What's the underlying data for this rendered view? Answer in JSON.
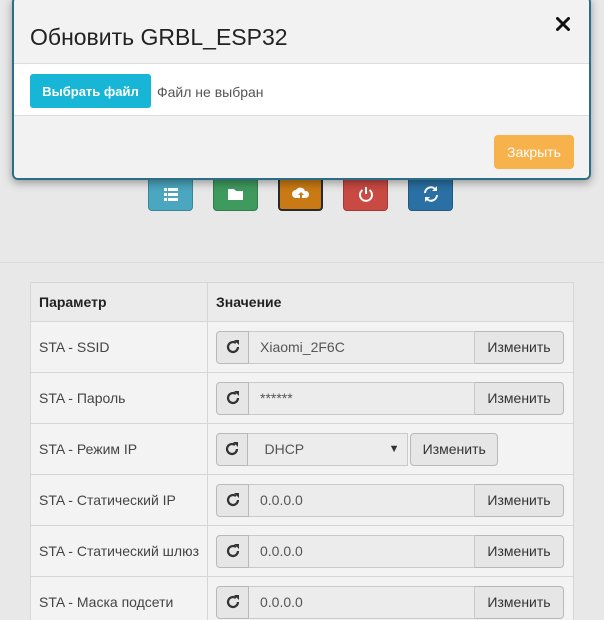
{
  "modal": {
    "title": "Обновить GRBL_ESP32",
    "choose_file_label": "Выбрать файл",
    "file_status": "Файл не выбран",
    "close_label": "Закрыть"
  },
  "toolbar": {
    "icons": [
      "list-icon",
      "folder-icon",
      "upload-icon",
      "power-icon",
      "refresh-icon"
    ],
    "colors": {
      "list": "#4aa7bf",
      "folder": "#3f9a5d",
      "upload": "#c97a14",
      "power": "#c94943",
      "refresh": "#2a70a4"
    }
  },
  "table": {
    "headers": [
      "Параметр",
      "Значение"
    ],
    "change_label": "Изменить",
    "rows": [
      {
        "param": "STA - SSID",
        "value": "Xiaomi_2F6C"
      },
      {
        "param": "STA - Пароль",
        "value": "******"
      },
      {
        "param": "STA - Режим IP",
        "value": "DHCP"
      },
      {
        "param": "STA - Статический IP",
        "value": "0.0.0.0"
      },
      {
        "param": "STA - Статический шлюз",
        "value": "0.0.0.0"
      },
      {
        "param": "STA - Маска подсети",
        "value": "0.0.0.0"
      }
    ]
  }
}
